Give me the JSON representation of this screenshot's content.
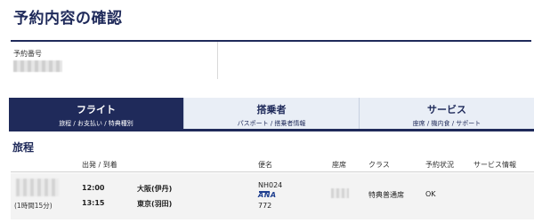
{
  "page": {
    "title": "予約内容の確認"
  },
  "reservation": {
    "label": "予約番号"
  },
  "tabs": [
    {
      "title": "フライト",
      "subtitle": "旅程 / お支払い / 特典種別",
      "active": true
    },
    {
      "title": "搭乗者",
      "subtitle": "パスポート / 搭乗者情報",
      "active": false
    },
    {
      "title": "サービス",
      "subtitle": "座席 / 機内食 / サポート",
      "active": false
    }
  ],
  "itinerary": {
    "title": "旅程",
    "headers": {
      "dep_arr": "出発 / 到着",
      "flight": "便名",
      "seat": "座席",
      "class": "クラス",
      "status": "予約状況",
      "service": "サービス情報"
    },
    "row": {
      "duration": "(1時間15分)",
      "dep_time": "12:00",
      "dep_airport": "大阪(伊丹)",
      "arr_time": "13:15",
      "arr_airport": "東京(羽田)",
      "flight_no": "NH024",
      "airline_logo_text": "ANA",
      "equipment": "772",
      "class": "特典普通席",
      "status": "OK"
    }
  },
  "colors": {
    "navy": "#1f2a5a",
    "tab_inactive": "#e9eef6",
    "row_bg": "#f3f3f3"
  }
}
